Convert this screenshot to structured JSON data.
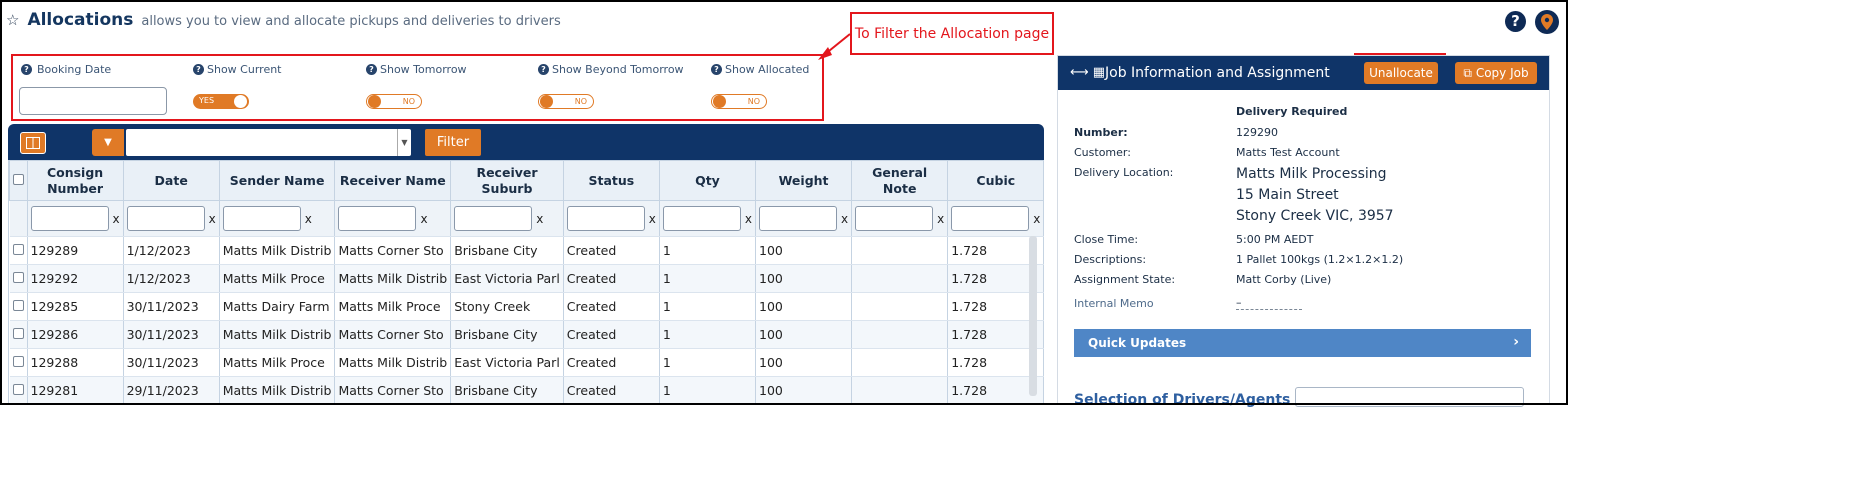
{
  "header": {
    "title": "Allocations",
    "subtitle": "allows you to view and allocate pickups and deliveries to drivers"
  },
  "annotation": {
    "filter_note": "To Filter the Allocation page",
    "color": "#e3161c"
  },
  "filters": {
    "booking_date": {
      "label": "Booking Date",
      "value": ""
    },
    "show_current": {
      "label": "Show Current",
      "state": "YES"
    },
    "show_tomorrow": {
      "label": "Show Tomorrow",
      "state": "NO"
    },
    "show_beyond_tomorrow": {
      "label": "Show Beyond Tomorrow",
      "state": "NO"
    },
    "show_allocated": {
      "label": "Show Allocated",
      "state": "NO"
    }
  },
  "toolbar": {
    "filter_button": "Filter",
    "search_value": ""
  },
  "table": {
    "columns": [
      "Consign Number",
      "Date",
      "Sender Name",
      "Receiver Name",
      "Receiver Suburb",
      "Status",
      "Qty",
      "Weight",
      "General Note",
      "Cubic"
    ],
    "clear_label": "x",
    "rows": [
      [
        "129289",
        "1/12/2023",
        "Matts Milk Distrib",
        "Matts Corner Sto",
        "Brisbane City",
        "Created",
        "1",
        "100",
        "",
        "1.728"
      ],
      [
        "129292",
        "1/12/2023",
        "Matts Milk Proce",
        "Matts Milk Distrib",
        "East Victoria Parl",
        "Created",
        "1",
        "100",
        "",
        "1.728"
      ],
      [
        "129285",
        "30/11/2023",
        "Matts Dairy Farm",
        "Matts Milk Proce",
        "Stony Creek",
        "Created",
        "1",
        "100",
        "",
        "1.728"
      ],
      [
        "129286",
        "30/11/2023",
        "Matts Milk Distrib",
        "Matts Corner Sto",
        "Brisbane City",
        "Created",
        "1",
        "100",
        "",
        "1.728"
      ],
      [
        "129288",
        "30/11/2023",
        "Matts Milk Proce",
        "Matts Milk Distrib",
        "East Victoria Parl",
        "Created",
        "1",
        "100",
        "",
        "1.728"
      ],
      [
        "129281",
        "29/11/2023",
        "Matts Milk Distrib",
        "Matts Corner Sto",
        "Brisbane City",
        "Created",
        "1",
        "100",
        "",
        "1.728"
      ]
    ]
  },
  "panel": {
    "title": "Job Information and Assignment",
    "unallocate_button": "Unallocate",
    "copy_job_button": "Copy Job",
    "delivery_required": "Delivery Required",
    "number_label": "Number:",
    "number_value": "129290",
    "customer_label": "Customer:",
    "customer_value": "Matts Test Account",
    "delivery_location_label": "Delivery Location:",
    "delivery_location": [
      "Matts Milk Processing",
      "15 Main Street",
      "Stony Creek VIC, 3957"
    ],
    "close_time_label": "Close Time:",
    "close_time_value": "5:00 PM AEDT",
    "descriptions_label": "Descriptions:",
    "descriptions_value": "1 Pallet 100kgs (1.2×1.2×1.2)",
    "assignment_state_label": "Assignment State:",
    "assignment_state_value": "Matt Corby (Live)",
    "internal_memo_label": "Internal Memo",
    "internal_memo_value": "–",
    "quick_updates": "Quick Updates",
    "drivers_title": "Selection of Drivers/Agents"
  },
  "colors": {
    "navy": "#0f3468",
    "orange": "#e07a26",
    "light_blue_bar": "#4f86c6"
  }
}
